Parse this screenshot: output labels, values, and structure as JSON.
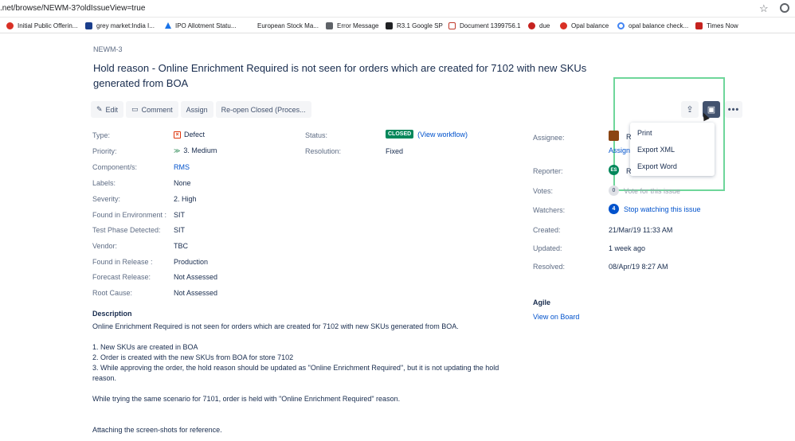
{
  "browser": {
    "url": ".net/browse/NEWM-3?oldIssueView=true",
    "bookmarks": [
      {
        "label": "Initial Public Offerin...",
        "color": "#d93025"
      },
      {
        "label": "grey market:India I...",
        "color": "#1a3e8c"
      },
      {
        "label": "IPO Allotment Statu...",
        "color": "#1a73e8"
      },
      {
        "label": "European Stock Ma...",
        "color": "#ffffff"
      },
      {
        "label": "Error Message",
        "color": "#5f6368"
      },
      {
        "label": "R3.1 Google SP",
        "color": "#202124"
      },
      {
        "label": "Document 1399756.1",
        "color": "#c0392b"
      },
      {
        "label": "due",
        "color": "#c5221f"
      },
      {
        "label": "Opal balance",
        "color": "#d93025"
      },
      {
        "label": "opal balance check...",
        "color": "#4285f4"
      },
      {
        "label": "Times Now",
        "color": "#c5221f"
      }
    ]
  },
  "issue": {
    "key": "NEWM-3",
    "title": "Hold reason - Online Enrichment Required is not seen for orders which are created for 7102 with new SKUs generated from BOA"
  },
  "toolbar": {
    "edit": "Edit",
    "comment": "Comment",
    "assign": "Assign",
    "reopen": "Re-open Closed (Proces..."
  },
  "export_menu": {
    "print": "Print",
    "export_xml": "Export XML",
    "export_word": "Export Word"
  },
  "details": {
    "type_label": "Type:",
    "type_value": "Defect",
    "priority_label": "Priority:",
    "priority_value": "3. Medium",
    "component_label": "Component/s:",
    "component_value": "RMS",
    "labels_label": "Labels:",
    "labels_value": "None",
    "severity_label": "Severity:",
    "severity_value": "2. High",
    "found_env_label": "Found in Environment :",
    "found_env_value": "SIT",
    "test_phase_label": "Test Phase Detected:",
    "test_phase_value": "SIT",
    "vendor_label": "Vendor:",
    "vendor_value": "TBC",
    "found_release_label": "Found in Release :",
    "found_release_value": "Production",
    "forecast_label": "Forecast Release:",
    "forecast_value": "Not Assessed",
    "root_cause_label": "Root Cause:",
    "root_cause_value": "Not Assessed",
    "status_label": "Status:",
    "status_value": "CLOSED",
    "workflow_link": "(View workflow)",
    "resolution_label": "Resolution:",
    "resolution_value": "Fixed"
  },
  "people": {
    "assignee_label": "Assignee:",
    "assignee_initial": "R",
    "assign_link": "Assign",
    "reporter_label": "Reporter:",
    "reporter_avatar": "ES",
    "reporter_initial": "R",
    "votes_label": "Votes:",
    "votes_count": "0",
    "votes_link": "Vote for this issue",
    "watchers_label": "Watchers:",
    "watchers_count": "4",
    "watchers_link": "Stop watching this issue"
  },
  "dates": {
    "created_label": "Created:",
    "created_value": "21/Mar/19 11:33 AM",
    "updated_label": "Updated:",
    "updated_value": "1 week ago",
    "resolved_label": "Resolved:",
    "resolved_value": "08/Apr/19 8:27 AM"
  },
  "agile": {
    "heading": "Agile",
    "board_link": "View on Board"
  },
  "description": {
    "heading": "Description",
    "line1": "Online Enrichment Required is not seen for orders which are created for 7102 with new SKUs generated from BOA.",
    "step1": "1. New SKUs are created in BOA",
    "step2": "2. Order is created with the new SKUs from BOA for store 7102",
    "step3": "3. While approving the order, the hold reason should be updated as \"Online Enrichment Required\", but it is not updating the hold reason.",
    "line2": "While trying the same scenario for 7101, order is held with \"Online Enrichment Required\" reason.",
    "line3": "Attaching the screen-shots for reference."
  },
  "colors": {
    "accent": "#0052cc",
    "highlight": "#6ed69a",
    "closed": "#00875a"
  }
}
